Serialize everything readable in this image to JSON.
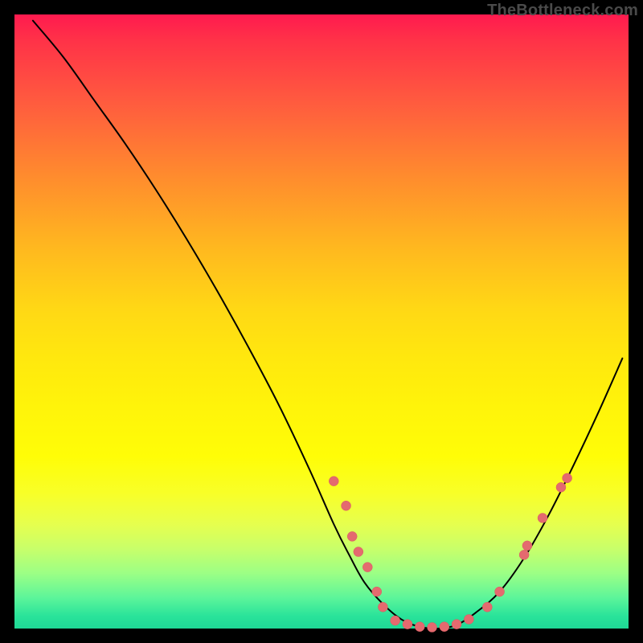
{
  "watermark": "TheBottleneck.com",
  "chart_data": {
    "type": "line",
    "title": "",
    "xlabel": "",
    "ylabel": "",
    "xlim": [
      0,
      100
    ],
    "ylim": [
      0,
      100
    ],
    "series": [
      {
        "name": "curve",
        "x": [
          3,
          8,
          13,
          18,
          23,
          28,
          33,
          38,
          43,
          48,
          52,
          54.5,
          57,
          60,
          63,
          66,
          69,
          72,
          75,
          79,
          83,
          87,
          91,
          95,
          99
        ],
        "y": [
          99,
          93,
          86,
          79,
          71.5,
          63.5,
          55,
          46,
          36.5,
          26,
          17,
          12,
          7.5,
          4,
          1.5,
          0.3,
          0,
          0.6,
          2.5,
          6,
          11.5,
          18.5,
          26.5,
          35,
          44
        ]
      }
    ],
    "markers": [
      {
        "x": 52.0,
        "y": 24.0
      },
      {
        "x": 54.0,
        "y": 20.0
      },
      {
        "x": 55.0,
        "y": 15.0
      },
      {
        "x": 56.0,
        "y": 12.5
      },
      {
        "x": 57.5,
        "y": 10.0
      },
      {
        "x": 59.0,
        "y": 6.0
      },
      {
        "x": 60.0,
        "y": 3.5
      },
      {
        "x": 62.0,
        "y": 1.3
      },
      {
        "x": 64.0,
        "y": 0.7
      },
      {
        "x": 66.0,
        "y": 0.3
      },
      {
        "x": 68.0,
        "y": 0.2
      },
      {
        "x": 70.0,
        "y": 0.3
      },
      {
        "x": 72.0,
        "y": 0.7
      },
      {
        "x": 74.0,
        "y": 1.5
      },
      {
        "x": 77.0,
        "y": 3.5
      },
      {
        "x": 79.0,
        "y": 6.0
      },
      {
        "x": 83.0,
        "y": 12.0
      },
      {
        "x": 83.5,
        "y": 13.5
      },
      {
        "x": 86.0,
        "y": 18.0
      },
      {
        "x": 89.0,
        "y": 23.0
      },
      {
        "x": 90.0,
        "y": 24.5
      }
    ],
    "colors": {
      "line": "#000000",
      "marker": "#e46a6f",
      "gradient_top": "#ff1a4f",
      "gradient_bottom": "#1fd896"
    }
  }
}
